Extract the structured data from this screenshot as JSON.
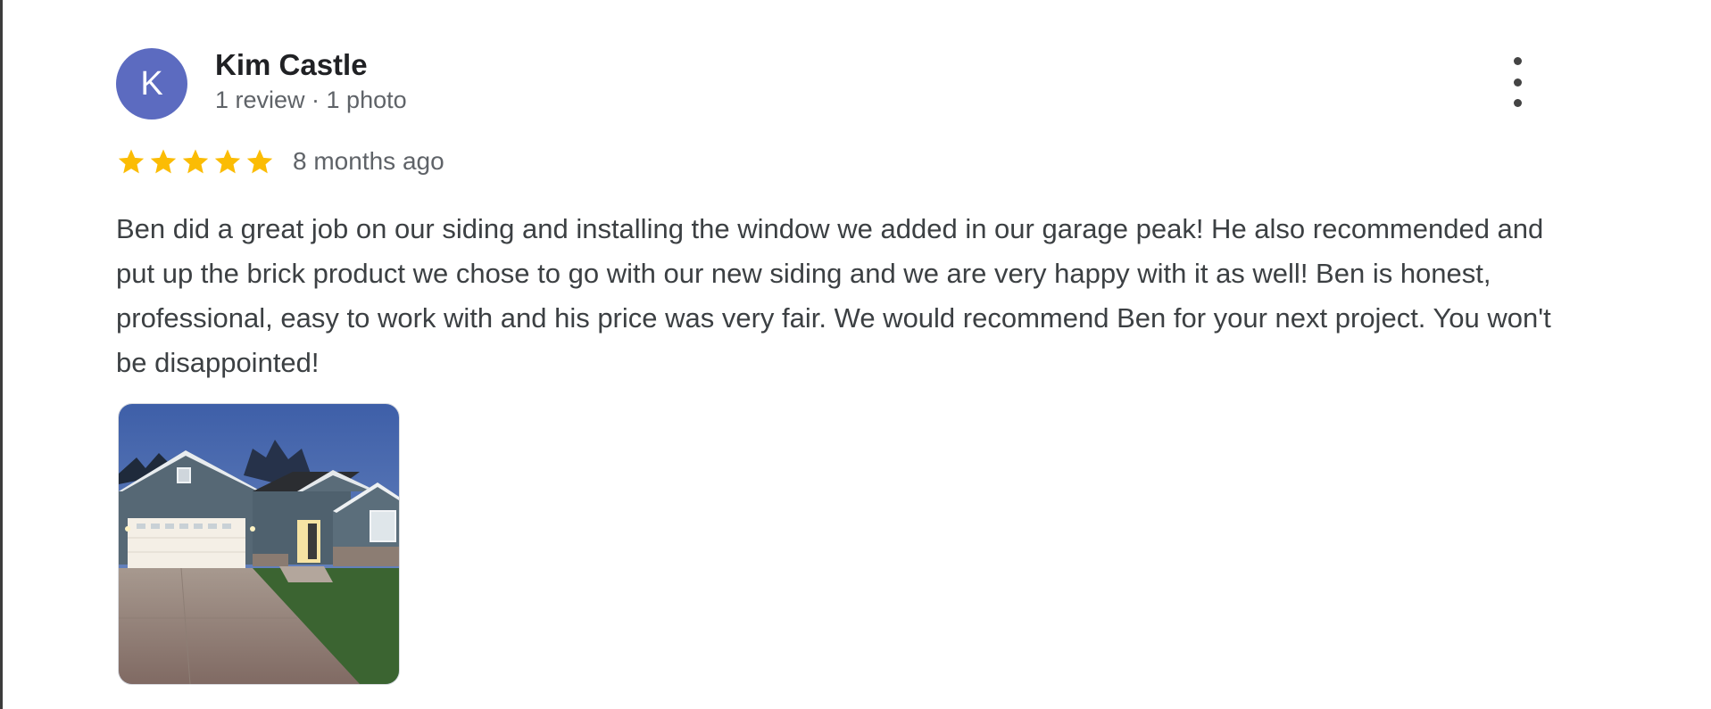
{
  "review": {
    "author": {
      "initial": "K",
      "name": "Kim Castle",
      "meta": "1 review · 1 photo",
      "avatar_color": "#5c6bc0"
    },
    "menu_icon": "more-vert-icon",
    "rating": {
      "stars": 5,
      "max": 5,
      "star_color": "#fbbc04"
    },
    "date": "8 months ago",
    "text": "Ben did a great job on our siding and installing the window we added in our garage peak! He also recommended and put up the brick product we chose to go with our new siding and we are very happy with it as well! Ben is honest, professional, easy to work with and his price was very fair. We would recommend Ben for your next project. You won't be disappointed!",
    "photos_count": 1
  }
}
